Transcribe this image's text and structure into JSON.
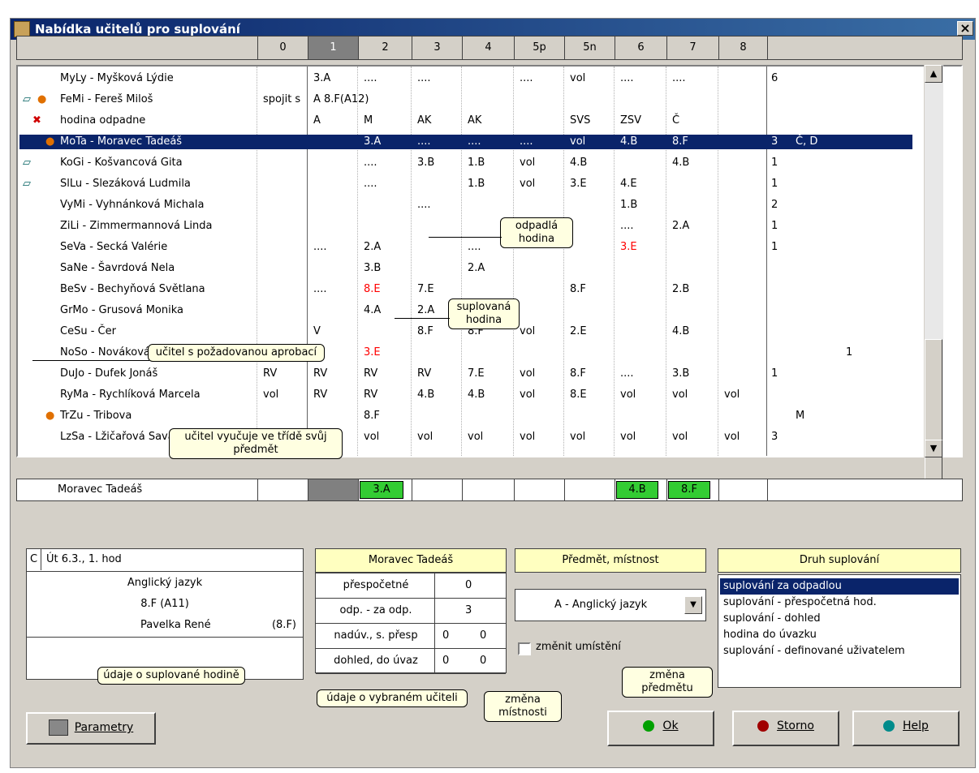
{
  "window": {
    "title": "Nabídka učitelů pro suplování",
    "close": "×"
  },
  "columns": [
    "",
    "0",
    "1",
    "2",
    "3",
    "4",
    "5p",
    "5n",
    "6",
    "7",
    "8",
    ""
  ],
  "rows": [
    {
      "name": "MyLy - Myšková Lýdie",
      "icons": "",
      "cells": [
        "",
        "3.A",
        "....",
        "....",
        "",
        "....",
        "vol",
        "....",
        "....",
        ""
      ],
      "count": "6",
      "extra": ""
    },
    {
      "name": "FeMi - Fereš Miloš",
      "icons": "book,person",
      "cells": [
        "spojit s",
        "A 8.F(A12)",
        "",
        "",
        "",
        "",
        "",
        "",
        "",
        ""
      ],
      "count": "",
      "extra": ""
    },
    {
      "name": "hodina odpadne",
      "icons": "cross",
      "cells": [
        "",
        "A",
        "M",
        "AK",
        "AK",
        "",
        "SVS",
        "ZSV",
        "Č",
        ""
      ],
      "count": "",
      "extra": ""
    },
    {
      "name": "MoTa - Moravec Tadeáš",
      "icons": "person",
      "cells": [
        "",
        "",
        "3.A",
        "....",
        "....",
        "....",
        "vol",
        "4.B",
        "8.F",
        ""
      ],
      "count": "3",
      "extra": "Č, D"
    },
    {
      "name": "KoGi - Košvancová Gita",
      "icons": "book",
      "cells": [
        "",
        "",
        "....",
        "3.B",
        "1.B",
        "vol",
        "4.B",
        "",
        "4.B",
        ""
      ],
      "count": "1",
      "extra": ""
    },
    {
      "name": "SlLu - Slezáková Ludmila",
      "icons": "book",
      "cells": [
        "",
        "",
        "....",
        "",
        "1.B",
        "vol",
        "3.E",
        "4.E",
        "",
        ""
      ],
      "count": "1",
      "extra": ""
    },
    {
      "name": "VyMi - Vyhnánková Michala",
      "icons": "",
      "cells": [
        "",
        "",
        "",
        "....",
        "",
        "",
        "",
        "1.B",
        "",
        ""
      ],
      "count": "2",
      "extra": ""
    },
    {
      "name": "ZiLi - Zimmermannová Linda",
      "icons": "",
      "cells": [
        "",
        "",
        "",
        "",
        "",
        "",
        "",
        "....",
        "2.A",
        ""
      ],
      "count": "1",
      "extra": ""
    },
    {
      "name": "SeVa - Secká Valérie",
      "icons": "",
      "cells": [
        "",
        "....",
        "2.A",
        "",
        "....",
        "",
        "",
        "3.E",
        "",
        ""
      ],
      "count": "1",
      "extra": ""
    },
    {
      "name": "SaNe - Šavrdová Nela",
      "icons": "",
      "cells": [
        "",
        "",
        "3.B",
        "",
        "2.A",
        "",
        "",
        "",
        "",
        ""
      ],
      "count": "",
      "extra": ""
    },
    {
      "name": "BeSv - Bechyňová Světlana",
      "icons": "",
      "cells": [
        "",
        "....",
        "8.E",
        "7.E",
        "",
        "",
        "8.F",
        "",
        "2.B",
        ""
      ],
      "count": "",
      "extra": ""
    },
    {
      "name": "GrMo - Grusová Monika",
      "icons": "",
      "cells": [
        "",
        "",
        "4.A",
        "2.A",
        "",
        "",
        "",
        "",
        "",
        ""
      ],
      "count": "",
      "extra": ""
    },
    {
      "name": "CeSu - Čer",
      "icons": "",
      "cells": [
        "",
        "V",
        "",
        "8.F",
        "8.F",
        "vol",
        "2.E",
        "",
        "4.B",
        ""
      ],
      "count": "",
      "extra": ""
    },
    {
      "name": "NoSo - Nováková Soňa",
      "icons": "",
      "cells": [
        "",
        "",
        "3.E",
        "",
        "",
        "",
        "",
        "",
        "",
        ""
      ],
      "count": "",
      "extra": "1"
    },
    {
      "name": "DuJo - Dufek Jonáš",
      "icons": "",
      "cells": [
        "RV",
        "RV",
        "RV",
        "RV",
        "7.E",
        "vol",
        "8.F",
        "....",
        "3.B",
        ""
      ],
      "count": "1",
      "extra": ""
    },
    {
      "name": "RyMa - Rychlíková Marcela",
      "icons": "",
      "cells": [
        "vol",
        "RV",
        "RV",
        "4.B",
        "4.B",
        "vol",
        "8.E",
        "vol",
        "vol",
        "vol"
      ],
      "count": "",
      "extra": ""
    },
    {
      "name": "TrZu - Tribova",
      "icons": "person",
      "cells": [
        "",
        "",
        "8.F",
        "",
        "",
        "",
        "",
        "",
        "",
        ""
      ],
      "count": "",
      "extra": "M"
    },
    {
      "name": "LzSa - Lžičařová Sava",
      "icons": "",
      "cells": [
        "vol",
        "vol",
        "vol",
        "vol",
        "vol",
        "vol",
        "vol",
        "vol",
        "vol",
        "vol"
      ],
      "count": "3",
      "extra": ""
    }
  ],
  "red_cells": [
    "SeVa-7",
    "BeSv-2",
    "NoSo-2"
  ],
  "callouts": {
    "odpadla": "odpadlá hodina",
    "suplovana": "suplovaná hodina",
    "aprobace": "učitel s požadovanou aprobací",
    "vyucuje": "učitel vyučuje ve třídě svůj předmět",
    "udaje_hodina": "údaje o suplované hodině",
    "udaje_ucitel": "údaje o vybraném učiteli",
    "zmena_mistnosti": "změna místnosti",
    "zmena_predmetu": "změna předmětu"
  },
  "summary": {
    "name": "Moravec Tadeáš",
    "green": [
      "3.A",
      "4.B",
      "8.F"
    ]
  },
  "lesson": {
    "letter": "C",
    "date": "Út 6.3., 1. hod",
    "subject": "Anglický jazyk",
    "class_room": "8.F (A11)",
    "teacher": "Pavelka René",
    "teacher_class": "(8.F)"
  },
  "teacher_stats": {
    "title": "Moravec Tadeáš",
    "rows": [
      {
        "label": "přespočetné",
        "v1": "0",
        "v2": ""
      },
      {
        "label": "odp. - za odp.",
        "v1": "3",
        "v2": ""
      },
      {
        "label": "nadúv., s. přesp",
        "v1": "0",
        "v2": "0"
      },
      {
        "label": "dohled, do úvaz",
        "v1": "0",
        "v2": "0"
      }
    ]
  },
  "subject_room": {
    "title": "Předmět, místnost",
    "value": "A - Anglický jazyk",
    "checkbox_label": "změnit umístění"
  },
  "supl_type": {
    "title": "Druh suplování",
    "options": [
      "suplování za odpadlou",
      "suplování - přespočetná hod.",
      "suplování - dohled",
      "hodina do úvazku",
      "suplování - definované uživatelem"
    ]
  },
  "buttons": {
    "parametry": "Parametry",
    "ok": "Ok",
    "storno": "Storno",
    "help": "Help"
  },
  "colors": {
    "highlight": "#0a246a",
    "green": "#33cc33",
    "red": "#ff0000",
    "ok_dot": "#00a000",
    "storno_dot": "#a00000",
    "help_dot": "#008b8b"
  }
}
